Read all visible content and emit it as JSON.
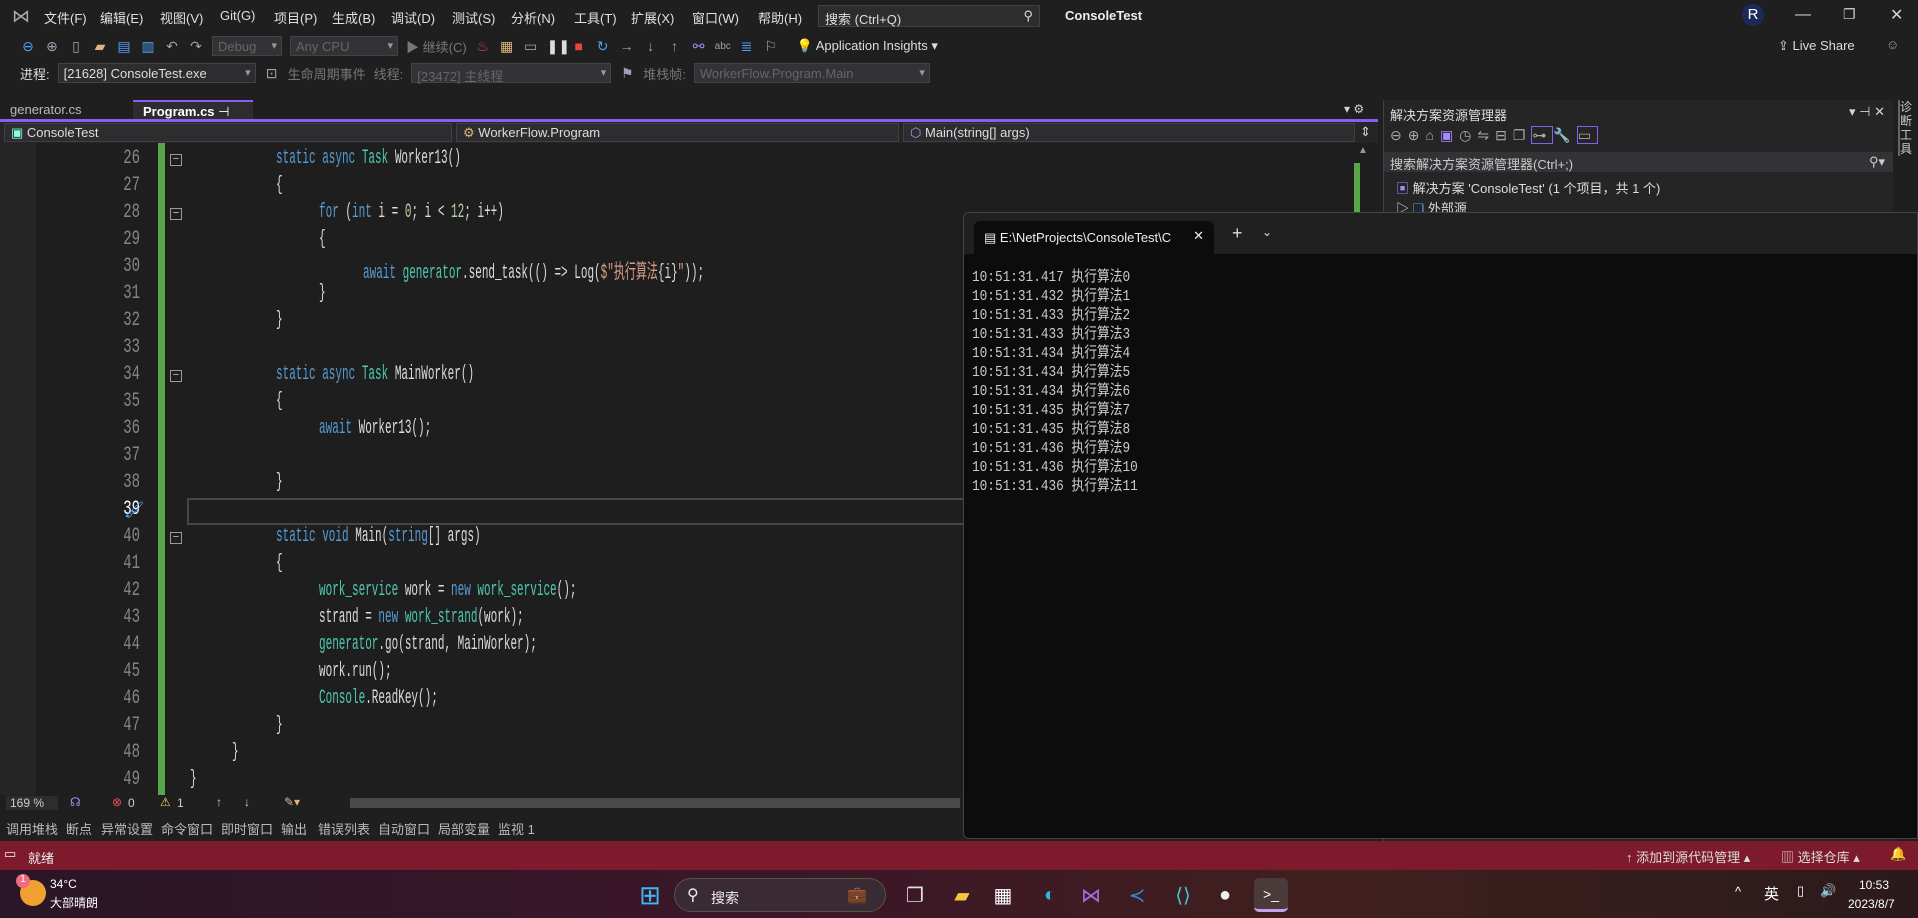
{
  "titlebar": {
    "menus": [
      "文件(F)",
      "编辑(E)",
      "视图(V)",
      "Git(G)",
      "项目(P)",
      "生成(B)",
      "调试(D)",
      "测试(S)",
      "分析(N)",
      "工具(T)",
      "扩展(X)",
      "窗口(W)",
      "帮助(H)"
    ],
    "search_placeholder": "搜索 (Ctrl+Q)",
    "title": "ConsoleTest",
    "avatar": "R"
  },
  "toolbar": {
    "config": "Debug",
    "platform": "Any CPU",
    "continue": "继续(C)",
    "app_insights": "Application Insights",
    "live_share": "Live Share"
  },
  "debugbar": {
    "process_label": "进程:",
    "process": "[21628] ConsoleTest.exe",
    "lifecycle": "生命周期事件",
    "thread_label": "线程:",
    "thread": "[23472] 主线程",
    "stack_label": "堆栈帧:",
    "stack": "WorkerFlow.Program.Main"
  },
  "doc_tabs": [
    {
      "label": "generator.cs",
      "active": false
    },
    {
      "label": "Program.cs",
      "active": true
    }
  ],
  "navbar": {
    "project": "ConsoleTest",
    "class": "WorkerFlow.Program",
    "member": "Main(string[] args)"
  },
  "code": {
    "current_line": 39,
    "folds": [
      26,
      28,
      34,
      40
    ],
    "lines": [
      {
        "n": 26,
        "i": 2,
        "t": [
          [
            "static async ",
            "kw"
          ],
          [
            "Task ",
            "ty"
          ],
          [
            "Worker13()",
            ""
          ]
        ]
      },
      {
        "n": 27,
        "i": 2,
        "t": [
          [
            "{",
            ""
          ]
        ]
      },
      {
        "n": 28,
        "i": 3,
        "t": [
          [
            "for ",
            "kw"
          ],
          [
            "(",
            ""
          ],
          [
            "int ",
            "kw"
          ],
          [
            "i = ",
            ""
          ],
          [
            "0",
            "num"
          ],
          [
            "; i < ",
            ""
          ],
          [
            "12",
            "num"
          ],
          [
            "; i++)",
            ""
          ]
        ]
      },
      {
        "n": 29,
        "i": 3,
        "t": [
          [
            "{",
            ""
          ]
        ]
      },
      {
        "n": 30,
        "i": 4,
        "t": [
          [
            "await ",
            "kw"
          ],
          [
            "generator",
            "ty"
          ],
          [
            ".send_task(() => Log(",
            ""
          ],
          [
            "$\"执行算法",
            "str"
          ],
          [
            "{i}",
            ""
          ],
          [
            "\"",
            "str"
          ],
          [
            "));",
            ""
          ]
        ]
      },
      {
        "n": 31,
        "i": 3,
        "t": [
          [
            "}",
            ""
          ]
        ]
      },
      {
        "n": 32,
        "i": 2,
        "t": [
          [
            "}",
            ""
          ]
        ]
      },
      {
        "n": 33,
        "i": 0,
        "t": []
      },
      {
        "n": 34,
        "i": 2,
        "t": [
          [
            "static async ",
            "kw"
          ],
          [
            "Task ",
            "ty"
          ],
          [
            "MainWorker()",
            ""
          ]
        ]
      },
      {
        "n": 35,
        "i": 2,
        "t": [
          [
            "{",
            ""
          ]
        ]
      },
      {
        "n": 36,
        "i": 3,
        "t": [
          [
            "await ",
            "kw"
          ],
          [
            "Worker13();",
            ""
          ]
        ]
      },
      {
        "n": 37,
        "i": 0,
        "t": []
      },
      {
        "n": 38,
        "i": 2,
        "t": [
          [
            "}",
            ""
          ]
        ]
      },
      {
        "n": 39,
        "i": 0,
        "t": []
      },
      {
        "n": 40,
        "i": 2,
        "t": [
          [
            "static void ",
            "kw"
          ],
          [
            "Main(",
            ""
          ],
          [
            "string",
            "kw"
          ],
          [
            "[] args)",
            ""
          ]
        ]
      },
      {
        "n": 41,
        "i": 2,
        "t": [
          [
            "{",
            ""
          ]
        ]
      },
      {
        "n": 42,
        "i": 3,
        "t": [
          [
            "work_service ",
            "ty"
          ],
          [
            "work = ",
            ""
          ],
          [
            "new ",
            "kw"
          ],
          [
            "work_service",
            "ty"
          ],
          [
            "();",
            ""
          ]
        ]
      },
      {
        "n": 43,
        "i": 3,
        "t": [
          [
            "strand = ",
            ""
          ],
          [
            "new ",
            "kw"
          ],
          [
            "work_strand",
            "ty"
          ],
          [
            "(work);",
            ""
          ]
        ]
      },
      {
        "n": 44,
        "i": 3,
        "t": [
          [
            "generator",
            "ty"
          ],
          [
            ".go(strand, MainWorker);",
            ""
          ]
        ]
      },
      {
        "n": 45,
        "i": 3,
        "t": [
          [
            "work.run();",
            ""
          ]
        ]
      },
      {
        "n": 46,
        "i": 3,
        "t": [
          [
            "Console",
            "ty"
          ],
          [
            ".ReadKey();",
            ""
          ]
        ]
      },
      {
        "n": 47,
        "i": 2,
        "t": [
          [
            "}",
            ""
          ]
        ]
      },
      {
        "n": 48,
        "i": 1,
        "t": [
          [
            "}",
            ""
          ]
        ]
      },
      {
        "n": 49,
        "i": 0,
        "t": [
          [
            "}",
            ""
          ]
        ]
      }
    ]
  },
  "editor_status": {
    "zoom": "169 %",
    "errors": "0",
    "warnings": "1"
  },
  "tool_tabs": [
    "调用堆栈",
    "断点",
    "异常设置",
    "命令窗口",
    "即时窗口",
    "输出",
    "错误列表",
    "自动窗口",
    "局部变量",
    "监视 1"
  ],
  "statusbar": {
    "state": "就绪",
    "source_control": "添加到源代码管理",
    "repo": "选择仓库"
  },
  "solution_explorer": {
    "title": "解决方案资源管理器",
    "search_placeholder": "搜索解决方案资源管理器(Ctrl+;)",
    "solution": "解决方案 'ConsoleTest' (1 个项目，共 1 个)",
    "external": "外部源",
    "side_label": "诊断工具"
  },
  "console": {
    "tab_title": "E:\\NetProjects\\ConsoleTest\\C",
    "lines": [
      "10:51:31.417 执行算法0",
      "10:51:31.432 执行算法1",
      "10:51:31.433 执行算法2",
      "10:51:31.433 执行算法3",
      "10:51:31.434 执行算法4",
      "10:51:31.434 执行算法5",
      "10:51:31.434 执行算法6",
      "10:51:31.435 执行算法7",
      "10:51:31.435 执行算法8",
      "10:51:31.436 执行算法9",
      "10:51:31.436 执行算法10",
      "10:51:31.436 执行算法11"
    ]
  },
  "taskbar": {
    "weather_temp": "34°C",
    "weather_desc": "大部晴朗",
    "weather_badge": "1",
    "search": "搜索",
    "ime": "英",
    "time": "10:53",
    "date": "2023/8/7",
    "apps": [
      "widgets-icon",
      "task-view-icon",
      "file-explorer-icon",
      "store-icon",
      "edge-icon",
      "visual-studio-icon",
      "vscode-icon",
      "jetbrains-icon",
      "wechat-icon",
      "terminal-icon"
    ]
  },
  "colors": {
    "accent": "#8b5cf6",
    "status_bar": "#7d1a2c",
    "changed_bar": "#57a64a"
  }
}
